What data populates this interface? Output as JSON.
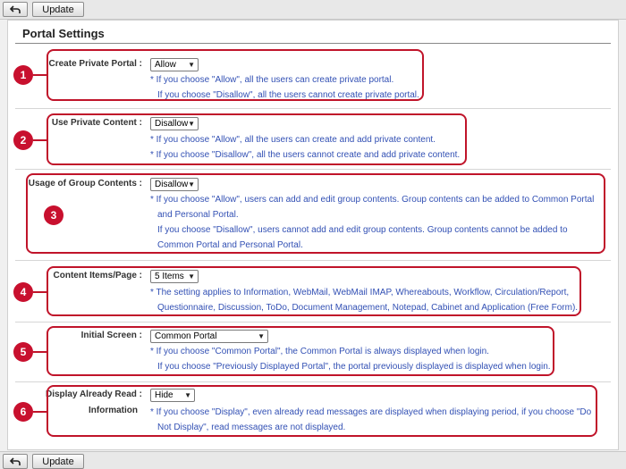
{
  "toolbar": {
    "back_icon": "back-arrow-icon",
    "update_label": "Update"
  },
  "page_title": "Portal Settings",
  "colors": {
    "callout": "#c0142a",
    "note_text": "#3250b4"
  },
  "settings": [
    {
      "number": "1",
      "label": "Create Private Portal",
      "value": "Allow",
      "notes": [
        "* If you choose \"Allow\", all the users can create private portal.",
        "If you choose \"Disallow\", all the users cannot create private portal."
      ]
    },
    {
      "number": "2",
      "label": "Use Private Content",
      "value": "Disallow",
      "notes": [
        "* If you choose \"Allow\", all the users can create and add private content.",
        "* If you choose \"Disallow\", all the users cannot create and add private content."
      ]
    },
    {
      "number": "3",
      "label": "Usage of Group Contents",
      "value": "Disallow",
      "notes": [
        "* If you choose \"Allow\", users can add and edit group contents. Group contents can be added to Common Portal",
        "and Personal Portal.",
        "If you choose \"Disallow\", users cannot add and edit group contents. Group contents cannot be added to",
        "Common Portal and Personal Portal."
      ]
    },
    {
      "number": "4",
      "label": "Content Items/Page",
      "value": "5 Items",
      "notes": [
        "* The setting applies to Information, WebMail, WebMail IMAP, Whereabouts, Workflow, Circulation/Report,",
        "Questionnaire, Discussion, ToDo, Document Management, Notepad, Cabinet and Application (Free Form)."
      ]
    },
    {
      "number": "5",
      "label": "Initial Screen",
      "value": "Common Portal",
      "notes": [
        "* If you choose \"Common Portal\", the Common Portal is always displayed when login.",
        "If you choose \"Previously Displayed Portal\", the portal previously displayed is displayed when login."
      ]
    },
    {
      "number": "6",
      "label": "Display Already Read",
      "label2": "Information",
      "value": "Hide",
      "notes": [
        "* If you choose \"Display\", even already read messages are displayed when displaying period, if you choose \"Do",
        "Not Display\", read messages are not displayed."
      ]
    }
  ]
}
